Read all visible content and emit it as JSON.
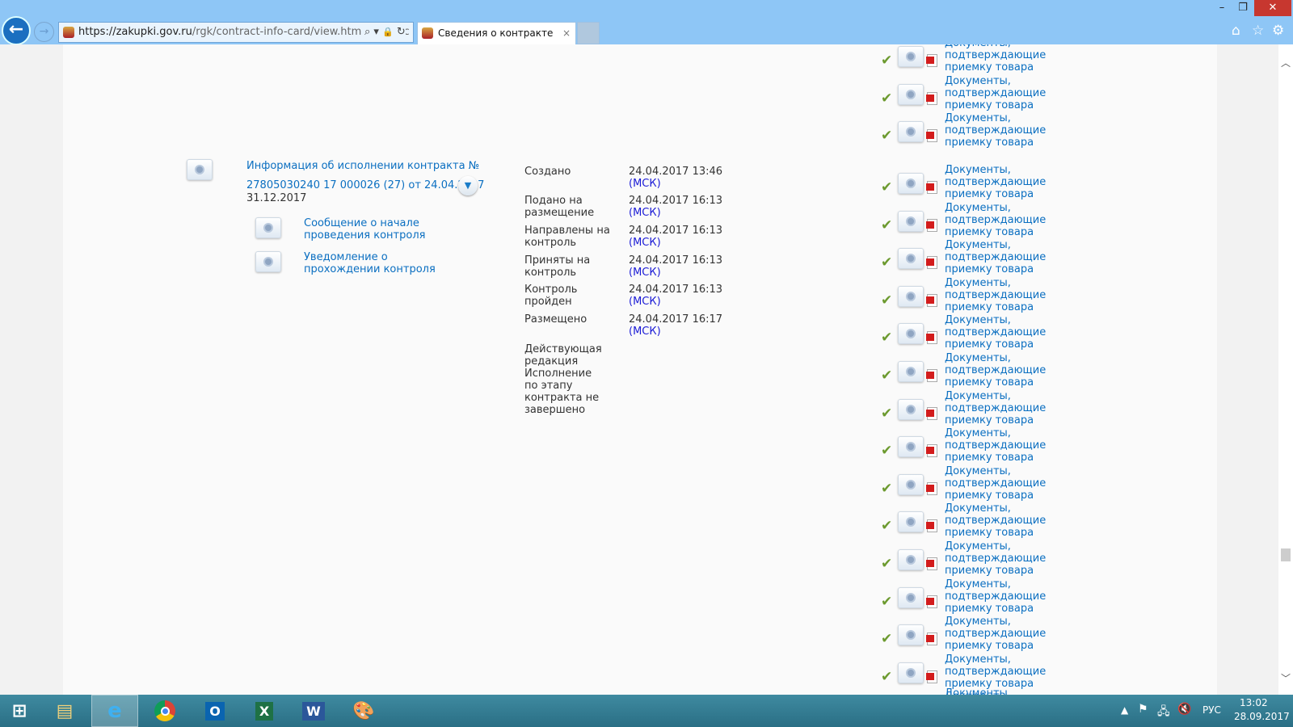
{
  "browser": {
    "url_host": "https://zakupki.gov.ru",
    "url_path": "/rgk/contract-info-card/view.html?contrac",
    "tab_title": "Сведения о контракте",
    "tab_close": "×",
    "back": "←",
    "forward": "→",
    "search_icon": "⌕",
    "lock_icon": "🔒",
    "refresh_icon": "↻",
    "minimize": "–",
    "restore": "❐",
    "close": "✕",
    "home": "⌂",
    "favorites": "☆",
    "settings": "⚙"
  },
  "contract": {
    "title_line1": "Информация об исполнении контракта №",
    "title_line2": "27805030240 17 000026 (27) от 24.04.2017",
    "date": "31.12.2017",
    "sub_items": [
      "Сообщение о начале проведения контроля",
      "Уведомление о прохождении контроля"
    ]
  },
  "status": [
    {
      "label": "Создано",
      "value": "24.04.2017 13:46",
      "tz": "(МСК)"
    },
    {
      "label": "Подано на размещение",
      "value": "24.04.2017 16:13",
      "tz": "(МСК)"
    },
    {
      "label": "Направлены на контроль",
      "value": "24.04.2017 16:13",
      "tz": "(МСК)"
    },
    {
      "label": "Приняты на контроль",
      "value": "24.04.2017 16:13",
      "tz": "(МСК)"
    },
    {
      "label": "Контроль пройден",
      "value": "24.04.2017 16:13",
      "tz": "(МСК)"
    },
    {
      "label": "Размещено",
      "value": "24.04.2017 16:17",
      "tz": "(МСК)"
    },
    {
      "label": "Действующая редакция Исполнение по этапу контракта не завершено"
    }
  ],
  "documents": {
    "label": "Документы, подтверждающие приемку товара",
    "count_top": 3,
    "count_bottom": 15,
    "partial_label": "Документы,"
  },
  "taskbar": {
    "apps": [
      "file-explorer",
      "internet-explorer",
      "chrome",
      "outlook",
      "excel",
      "word",
      "paint"
    ],
    "language": "РУС",
    "time": "13:02",
    "date": "28.09.2017"
  },
  "colors": {
    "link": "#0b6fc1",
    "msk": "#1b1bd6",
    "chrome": "#8ec6f6"
  }
}
